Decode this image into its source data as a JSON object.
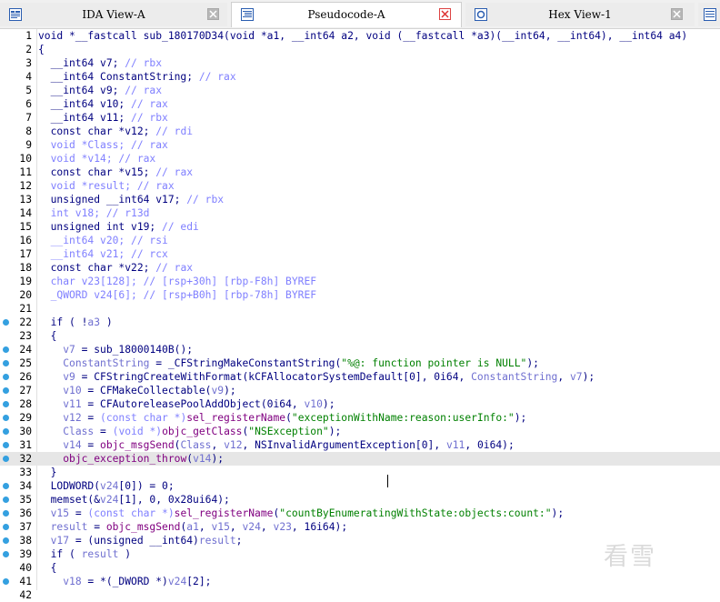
{
  "tabs": [
    {
      "label": "IDA View-A",
      "icon": "ida-view-icon",
      "active": false
    },
    {
      "label": "Pseudocode-A",
      "icon": "pseudocode-icon",
      "active": true
    },
    {
      "label": "Hex View-1",
      "icon": "hex-view-icon",
      "active": false
    }
  ],
  "watermark": "看雪",
  "code_lines": [
    {
      "n": "1",
      "bp": false,
      "parts": [
        [
          "plain",
          "void *__fastcall sub_180170D34(void *a1, __int64 a2, void (__fastcall *a3)(__int64, __int64), __int64 a4)"
        ]
      ]
    },
    {
      "n": "2",
      "bp": false,
      "parts": [
        [
          "plain",
          "{"
        ]
      ]
    },
    {
      "n": "3",
      "bp": false,
      "parts": [
        [
          "plain",
          "  __int64 v7; "
        ],
        [
          "cmt",
          "// rbx"
        ]
      ]
    },
    {
      "n": "4",
      "bp": false,
      "parts": [
        [
          "plain",
          "  __int64 ConstantString; "
        ],
        [
          "cmt",
          "// rax"
        ]
      ]
    },
    {
      "n": "5",
      "bp": false,
      "parts": [
        [
          "plain",
          "  __int64 v9; "
        ],
        [
          "cmt",
          "// rax"
        ]
      ]
    },
    {
      "n": "6",
      "bp": false,
      "parts": [
        [
          "plain",
          "  __int64 v10; "
        ],
        [
          "cmt",
          "// rax"
        ]
      ]
    },
    {
      "n": "7",
      "bp": false,
      "parts": [
        [
          "plain",
          "  __int64 v11; "
        ],
        [
          "cmt",
          "// rbx"
        ]
      ]
    },
    {
      "n": "8",
      "bp": false,
      "parts": [
        [
          "plain",
          "  const char *v12; "
        ],
        [
          "cmt",
          "// rdi"
        ]
      ]
    },
    {
      "n": "9",
      "bp": false,
      "parts": [
        [
          "cmt",
          "  void *Class; // rax"
        ]
      ]
    },
    {
      "n": "10",
      "bp": false,
      "parts": [
        [
          "cmt",
          "  void *v14; // rax"
        ]
      ]
    },
    {
      "n": "11",
      "bp": false,
      "parts": [
        [
          "plain",
          "  const char *v15; "
        ],
        [
          "cmt",
          "// rax"
        ]
      ]
    },
    {
      "n": "12",
      "bp": false,
      "parts": [
        [
          "cmt",
          "  void *result; // rax"
        ]
      ]
    },
    {
      "n": "13",
      "bp": false,
      "parts": [
        [
          "plain",
          "  unsigned __int64 v17; "
        ],
        [
          "cmt",
          "// rbx"
        ]
      ]
    },
    {
      "n": "14",
      "bp": false,
      "parts": [
        [
          "cmt",
          "  int v18; // r13d"
        ]
      ]
    },
    {
      "n": "15",
      "bp": false,
      "parts": [
        [
          "plain",
          "  unsigned int v19; "
        ],
        [
          "cmt",
          "// edi"
        ]
      ]
    },
    {
      "n": "16",
      "bp": false,
      "parts": [
        [
          "cmt",
          "  __int64 v20; // rsi"
        ]
      ]
    },
    {
      "n": "17",
      "bp": false,
      "parts": [
        [
          "cmt",
          "  __int64 v21; // rcx"
        ]
      ]
    },
    {
      "n": "18",
      "bp": false,
      "parts": [
        [
          "plain",
          "  const char *v22; "
        ],
        [
          "cmt",
          "// rax"
        ]
      ]
    },
    {
      "n": "19",
      "bp": false,
      "parts": [
        [
          "cmt",
          "  char v23[128]; // [rsp+30h] [rbp-F8h] BYREF"
        ]
      ]
    },
    {
      "n": "20",
      "bp": false,
      "parts": [
        [
          "cmt",
          "  _QWORD v24[6]; // [rsp+B0h] [rbp-78h] BYREF"
        ]
      ]
    },
    {
      "n": "21",
      "bp": false,
      "parts": [
        [
          "plain",
          ""
        ]
      ]
    },
    {
      "n": "22",
      "bp": true,
      "parts": [
        [
          "plain",
          "  if ( !"
        ],
        [
          "var",
          "a3"
        ],
        [
          "plain",
          " )"
        ]
      ]
    },
    {
      "n": "23",
      "bp": false,
      "parts": [
        [
          "plain",
          "  {"
        ]
      ]
    },
    {
      "n": "24",
      "bp": true,
      "parts": [
        [
          "plain",
          "    "
        ],
        [
          "var",
          "v7"
        ],
        [
          "plain",
          " = sub_18000140B();"
        ]
      ]
    },
    {
      "n": "25",
      "bp": true,
      "parts": [
        [
          "plain",
          "    "
        ],
        [
          "var",
          "ConstantString"
        ],
        [
          "plain",
          " = _CFStringMakeConstantString("
        ],
        [
          "str",
          "\"%@: function pointer is NULL\""
        ],
        [
          "plain",
          ");"
        ]
      ]
    },
    {
      "n": "26",
      "bp": true,
      "parts": [
        [
          "plain",
          "    "
        ],
        [
          "var",
          "v9"
        ],
        [
          "plain",
          " = CFStringCreateWithFormat(kCFAllocatorSystemDefault[0], 0i64, "
        ],
        [
          "var",
          "ConstantString"
        ],
        [
          "plain",
          ", "
        ],
        [
          "var",
          "v7"
        ],
        [
          "plain",
          ");"
        ]
      ]
    },
    {
      "n": "27",
      "bp": true,
      "parts": [
        [
          "plain",
          "    "
        ],
        [
          "var",
          "v10"
        ],
        [
          "plain",
          " = CFMakeCollectable("
        ],
        [
          "var",
          "v9"
        ],
        [
          "plain",
          ");"
        ]
      ]
    },
    {
      "n": "28",
      "bp": true,
      "parts": [
        [
          "plain",
          "    "
        ],
        [
          "var",
          "v11"
        ],
        [
          "plain",
          " = CFAutoreleasePoolAddObject(0i64, "
        ],
        [
          "var",
          "v10"
        ],
        [
          "plain",
          ");"
        ]
      ]
    },
    {
      "n": "29",
      "bp": true,
      "parts": [
        [
          "plain",
          "    "
        ],
        [
          "var",
          "v12"
        ],
        [
          "plain",
          " = "
        ],
        [
          "cmt",
          "(const char *)"
        ],
        [
          "call",
          "sel_registerName"
        ],
        [
          "plain",
          "("
        ],
        [
          "str",
          "\"exceptionWithName:reason:userInfo:\""
        ],
        [
          "plain",
          ");"
        ]
      ]
    },
    {
      "n": "30",
      "bp": true,
      "parts": [
        [
          "plain",
          "    "
        ],
        [
          "var",
          "Class"
        ],
        [
          "plain",
          " = "
        ],
        [
          "cmt",
          "(void *)"
        ],
        [
          "call",
          "objc_getClass"
        ],
        [
          "plain",
          "("
        ],
        [
          "str",
          "\"NSException\""
        ],
        [
          "plain",
          ");"
        ]
      ]
    },
    {
      "n": "31",
      "bp": true,
      "parts": [
        [
          "plain",
          "    "
        ],
        [
          "var",
          "v14"
        ],
        [
          "plain",
          " = "
        ],
        [
          "call",
          "objc_msgSend"
        ],
        [
          "plain",
          "("
        ],
        [
          "var",
          "Class"
        ],
        [
          "plain",
          ", "
        ],
        [
          "var",
          "v12"
        ],
        [
          "plain",
          ", NSInvalidArgumentException[0], "
        ],
        [
          "var",
          "v11"
        ],
        [
          "plain",
          ", 0i64);"
        ]
      ]
    },
    {
      "n": "32",
      "bp": true,
      "hl": true,
      "parts": [
        [
          "plain",
          "    "
        ],
        [
          "call",
          "objc_exception_throw"
        ],
        [
          "plain",
          "("
        ],
        [
          "var",
          "v14"
        ],
        [
          "plain",
          ");"
        ]
      ]
    },
    {
      "n": "33",
      "bp": false,
      "parts": [
        [
          "plain",
          "  }"
        ]
      ]
    },
    {
      "n": "34",
      "bp": true,
      "parts": [
        [
          "plain",
          "  LODWORD("
        ],
        [
          "var",
          "v24"
        ],
        [
          "plain",
          "[0]) = 0;"
        ]
      ]
    },
    {
      "n": "35",
      "bp": true,
      "parts": [
        [
          "plain",
          "  memset(&"
        ],
        [
          "var",
          "v24"
        ],
        [
          "plain",
          "[1], 0, 0x28ui64);"
        ]
      ]
    },
    {
      "n": "36",
      "bp": true,
      "parts": [
        [
          "plain",
          "  "
        ],
        [
          "var",
          "v15"
        ],
        [
          "plain",
          " = "
        ],
        [
          "cmt",
          "(const char *)"
        ],
        [
          "call",
          "sel_registerName"
        ],
        [
          "plain",
          "("
        ],
        [
          "str",
          "\"countByEnumeratingWithState:objects:count:\""
        ],
        [
          "plain",
          ");"
        ]
      ]
    },
    {
      "n": "37",
      "bp": true,
      "parts": [
        [
          "plain",
          "  "
        ],
        [
          "var",
          "result"
        ],
        [
          "plain",
          " = "
        ],
        [
          "call",
          "objc_msgSend"
        ],
        [
          "plain",
          "("
        ],
        [
          "var",
          "a1"
        ],
        [
          "plain",
          ", "
        ],
        [
          "var",
          "v15"
        ],
        [
          "plain",
          ", "
        ],
        [
          "var",
          "v24"
        ],
        [
          "plain",
          ", "
        ],
        [
          "var",
          "v23"
        ],
        [
          "plain",
          ", 16i64);"
        ]
      ]
    },
    {
      "n": "38",
      "bp": true,
      "parts": [
        [
          "plain",
          "  "
        ],
        [
          "var",
          "v17"
        ],
        [
          "plain",
          " = (unsigned __int64)"
        ],
        [
          "var",
          "result"
        ],
        [
          "plain",
          ";"
        ]
      ]
    },
    {
      "n": "39",
      "bp": true,
      "parts": [
        [
          "plain",
          "  if ( "
        ],
        [
          "var",
          "result"
        ],
        [
          "plain",
          " )"
        ]
      ]
    },
    {
      "n": "40",
      "bp": false,
      "parts": [
        [
          "plain",
          "  {"
        ]
      ]
    },
    {
      "n": "41",
      "bp": true,
      "parts": [
        [
          "plain",
          "    "
        ],
        [
          "var",
          "v18"
        ],
        [
          "plain",
          " = *(_DWORD *)"
        ],
        [
          "var",
          "v24"
        ],
        [
          "plain",
          "[2];"
        ]
      ]
    },
    {
      "n": "42",
      "bp": false,
      "parts": [
        [
          "plain",
          "    "
        ]
      ]
    }
  ]
}
